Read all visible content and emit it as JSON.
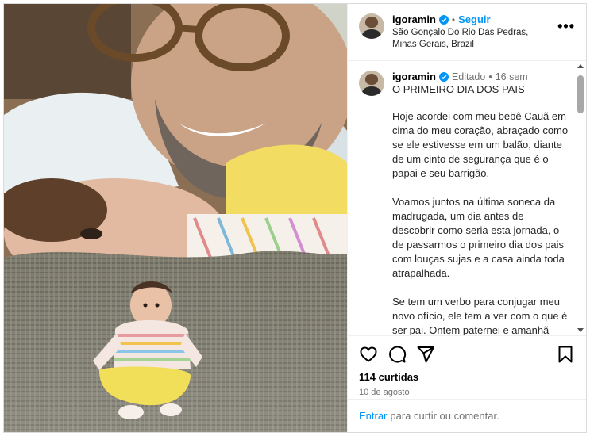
{
  "post": {
    "username": "igoramin",
    "follow_label": "Seguir",
    "separator": "•",
    "location": "São Gonçalo Do Rio Das Pedras, Minas Gerais, Brazil",
    "more_label": "•••"
  },
  "caption": {
    "username": "igoramin",
    "edited_label": "Editado",
    "separator": "•",
    "age": "16 sem",
    "title": "O PRIMEIRO DIA DOS PAIS",
    "paragraphs": [
      "Hoje acordei com meu bebê Cauã em cima do meu coração, abraçado como se ele estivesse em um balão, diante de um cinto de segurança que é o papai e seu barrigão.",
      "Voamos juntos na última soneca da madrugada, um dia antes de descobrir como seria esta jornada, o de passarmos o primeiro dia dos pais com louças sujas e a casa ainda toda atrapalhada.",
      "Se tem um verbo para conjugar meu novo ofício, ele tem a ver com o que é ser pai. Ontem paternei e amanhã paternarei sem querer nada mais."
    ]
  },
  "actions": {
    "icons": [
      "heart-icon",
      "comment-icon",
      "share-icon",
      "bookmark-icon"
    ],
    "likes": "114 curtidas",
    "date": "10 de agosto"
  },
  "add_comment": {
    "login_label": "Entrar",
    "rest_label": "para curtir ou comentar."
  },
  "colors": {
    "accent": "#0095f6",
    "muted": "#737373",
    "border": "#dbdbdb"
  }
}
